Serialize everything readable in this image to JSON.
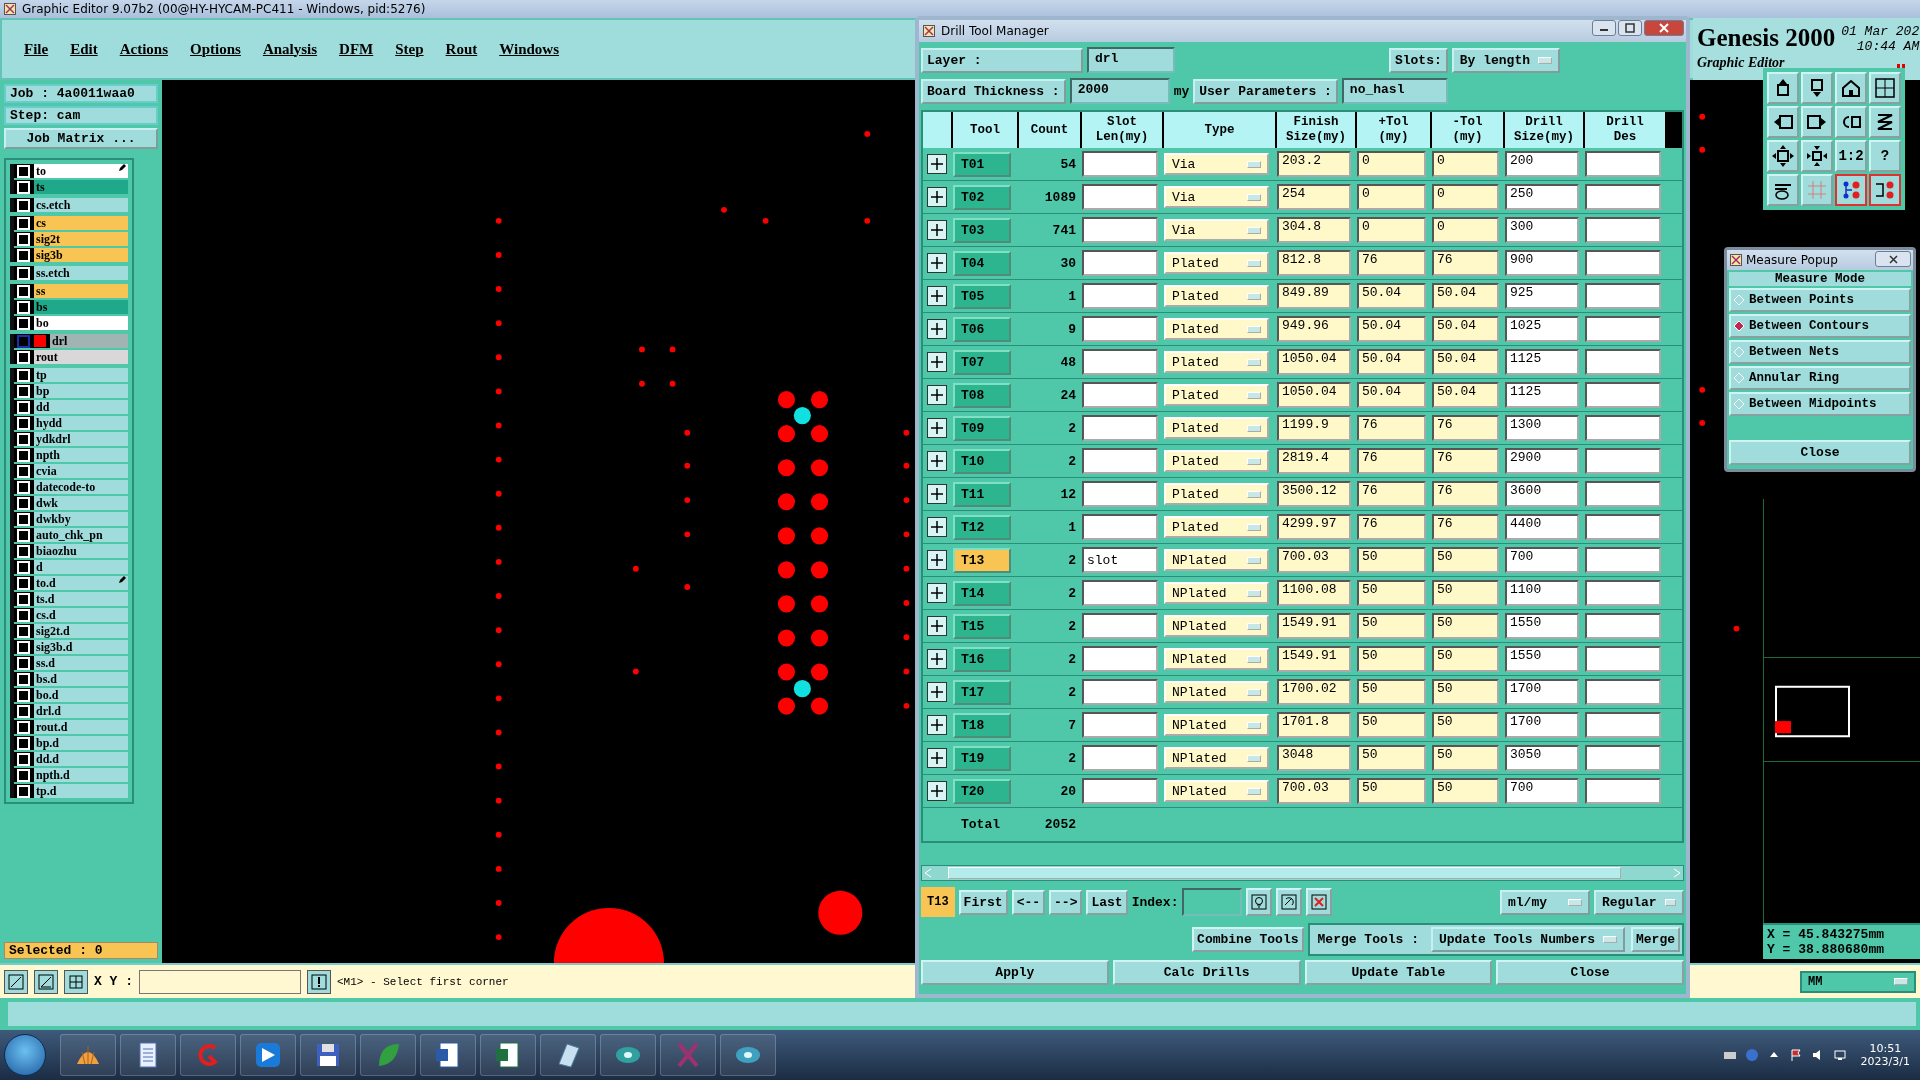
{
  "app_window": {
    "title": "Graphic Editor 9.07b2 (00@HY-HYCAM-PC411 - Windows, pid:5276)"
  },
  "menu": [
    "File",
    "Edit",
    "Actions",
    "Options",
    "Analysis",
    "DFM",
    "Step",
    "Rout",
    "Windows"
  ],
  "job": {
    "job": "Job : 4a0011waa0",
    "step": "Step: cam",
    "matrix_button": "Job Matrix ..."
  },
  "layer_groups": [
    {
      "layers": [
        {
          "name": "to",
          "color": "#ffffff",
          "selected": false,
          "marked": true
        },
        {
          "name": "ts",
          "color": "#1fa88a",
          "selected": false,
          "marked": false
        }
      ]
    },
    {
      "layers": [
        {
          "name": "cs.etch",
          "color": "#a0dcdc",
          "selected": false,
          "marked": false
        }
      ]
    },
    {
      "layers": [
        {
          "name": "cs",
          "color": "#f8c454",
          "selected": false,
          "marked": false
        },
        {
          "name": "sig2t",
          "color": "#f8c454",
          "selected": false,
          "marked": false
        },
        {
          "name": "sig3b",
          "color": "#f8c454",
          "selected": false,
          "marked": false
        }
      ]
    },
    {
      "layers": [
        {
          "name": "ss.etch",
          "color": "#a0dcdc",
          "selected": false,
          "marked": false
        }
      ]
    },
    {
      "layers": [
        {
          "name": "ss",
          "color": "#f8c454",
          "selected": false,
          "marked": false
        },
        {
          "name": "bs",
          "color": "#1fa88a",
          "selected": false,
          "marked": false
        },
        {
          "name": "bo",
          "color": "#ffffff",
          "selected": false,
          "marked": false
        }
      ]
    },
    {
      "layers": [
        {
          "name": "drl",
          "color": "#a0b4b4",
          "selected": true,
          "marked": false
        },
        {
          "name": "rout",
          "color": "#d8d8d8",
          "selected": false,
          "marked": false
        }
      ]
    },
    {
      "layers": [
        {
          "name": "tp",
          "color": "#a0dcdc",
          "selected": false,
          "marked": false
        },
        {
          "name": "bp",
          "color": "#a0dcdc",
          "selected": false,
          "marked": false
        },
        {
          "name": "dd",
          "color": "#a0dcdc",
          "selected": false,
          "marked": false
        },
        {
          "name": "hydd",
          "color": "#a0dcdc",
          "selected": false,
          "marked": false
        },
        {
          "name": "ydkdrl",
          "color": "#a0dcdc",
          "selected": false,
          "marked": false
        },
        {
          "name": "npth",
          "color": "#a0dcdc",
          "selected": false,
          "marked": false
        },
        {
          "name": "cvia",
          "color": "#a0dcdc",
          "selected": false,
          "marked": false
        },
        {
          "name": "datecode-to",
          "color": "#a0dcdc",
          "selected": false,
          "marked": false
        },
        {
          "name": "dwk",
          "color": "#a0dcdc",
          "selected": false,
          "marked": false
        },
        {
          "name": "dwkby",
          "color": "#a0dcdc",
          "selected": false,
          "marked": false
        },
        {
          "name": "auto_chk_pn",
          "color": "#a0dcdc",
          "selected": false,
          "marked": false
        },
        {
          "name": "biaozhu",
          "color": "#a0dcdc",
          "selected": false,
          "marked": false
        },
        {
          "name": "d",
          "color": "#a0dcdc",
          "selected": false,
          "marked": false
        },
        {
          "name": "to.d",
          "color": "#a0dcdc",
          "selected": false,
          "marked": true
        },
        {
          "name": "ts.d",
          "color": "#a0dcdc",
          "selected": false,
          "marked": false
        },
        {
          "name": "cs.d",
          "color": "#a0dcdc",
          "selected": false,
          "marked": false
        },
        {
          "name": "sig2t.d",
          "color": "#a0dcdc",
          "selected": false,
          "marked": false
        },
        {
          "name": "sig3b.d",
          "color": "#a0dcdc",
          "selected": false,
          "marked": false
        },
        {
          "name": "ss.d",
          "color": "#a0dcdc",
          "selected": false,
          "marked": false
        },
        {
          "name": "bs.d",
          "color": "#a0dcdc",
          "selected": false,
          "marked": false
        },
        {
          "name": "bo.d",
          "color": "#a0dcdc",
          "selected": false,
          "marked": false
        },
        {
          "name": "drl.d",
          "color": "#a0dcdc",
          "selected": false,
          "marked": false
        },
        {
          "name": "rout.d",
          "color": "#a0dcdc",
          "selected": false,
          "marked": false
        },
        {
          "name": "bp.d",
          "color": "#a0dcdc",
          "selected": false,
          "marked": false
        },
        {
          "name": "dd.d",
          "color": "#a0dcdc",
          "selected": false,
          "marked": false
        },
        {
          "name": "npth.d",
          "color": "#a0dcdc",
          "selected": false,
          "marked": false
        },
        {
          "name": "tp.d",
          "color": "#a0dcdc",
          "selected": false,
          "marked": false
        }
      ]
    }
  ],
  "selected_count": "Selected : 0",
  "brand": {
    "name": "Genesis 2000",
    "subtitle": "Graphic Editor",
    "date": "01 Mar 202",
    "time": "10:44 AM"
  },
  "toolbar": [
    {
      "on": false
    },
    {
      "on": false
    },
    {
      "on": false
    },
    {
      "on": false
    },
    {
      "on": false
    },
    {
      "on": false
    },
    {
      "on": false
    },
    {
      "on": false
    },
    {
      "on": false
    },
    {
      "on": false
    },
    {
      "label": "1:2",
      "on": false
    },
    {
      "label": "?",
      "on": false
    },
    {
      "on": false
    },
    {
      "on": false
    },
    {
      "on": true
    },
    {
      "on": true
    }
  ],
  "coordinates": {
    "x": "X = 45.843275mm",
    "y": "Y = 38.880680mm"
  },
  "command_bar": {
    "xy_label": "X Y :",
    "prompt": "<M1> - Select first corner",
    "units": "MM"
  },
  "drill_tool_manager": {
    "title": "Drill Tool Manager",
    "layer_label": "Layer :",
    "layer_value": "drl",
    "slots_label": "Slots:",
    "slots_value": "By length",
    "thickness_label": "Board Thickness :",
    "thickness_value": "2000",
    "thickness_unit": "my",
    "user_params_label": "User Parameters :",
    "user_params_value": "no_hasl",
    "columns": [
      "Tool",
      "Count",
      "Slot\nLen(my)",
      "Type",
      "Finish\nSize(my)",
      "+Tol\n(my)",
      "-Tol\n(my)",
      "Drill\nSize(my)",
      "Drill\nDes"
    ],
    "rows": [
      {
        "tool": "T01",
        "count": "54",
        "slot_len": "",
        "type": "Via",
        "finish": "203.2",
        "plus_tol": "0",
        "minus_tol": "0",
        "drill_size": "200",
        "selected": false
      },
      {
        "tool": "T02",
        "count": "1089",
        "slot_len": "",
        "type": "Via",
        "finish": "254",
        "plus_tol": "0",
        "minus_tol": "0",
        "drill_size": "250",
        "selected": false
      },
      {
        "tool": "T03",
        "count": "741",
        "slot_len": "",
        "type": "Via",
        "finish": "304.8",
        "plus_tol": "0",
        "minus_tol": "0",
        "drill_size": "300",
        "selected": false
      },
      {
        "tool": "T04",
        "count": "30",
        "slot_len": "",
        "type": "Plated",
        "finish": "812.8",
        "plus_tol": "76",
        "minus_tol": "76",
        "drill_size": "900",
        "selected": false
      },
      {
        "tool": "T05",
        "count": "1",
        "slot_len": "",
        "type": "Plated",
        "finish": "849.89",
        "plus_tol": "50.04",
        "minus_tol": "50.04",
        "drill_size": "925",
        "selected": false
      },
      {
        "tool": "T06",
        "count": "9",
        "slot_len": "",
        "type": "Plated",
        "finish": "949.96",
        "plus_tol": "50.04",
        "minus_tol": "50.04",
        "drill_size": "1025",
        "selected": false
      },
      {
        "tool": "T07",
        "count": "48",
        "slot_len": "",
        "type": "Plated",
        "finish": "1050.04",
        "plus_tol": "50.04",
        "minus_tol": "50.04",
        "drill_size": "1125",
        "selected": false
      },
      {
        "tool": "T08",
        "count": "24",
        "slot_len": "",
        "type": "Plated",
        "finish": "1050.04",
        "plus_tol": "50.04",
        "minus_tol": "50.04",
        "drill_size": "1125",
        "selected": false
      },
      {
        "tool": "T09",
        "count": "2",
        "slot_len": "",
        "type": "Plated",
        "finish": "1199.9",
        "plus_tol": "76",
        "minus_tol": "76",
        "drill_size": "1300",
        "selected": false
      },
      {
        "tool": "T10",
        "count": "2",
        "slot_len": "",
        "type": "Plated",
        "finish": "2819.4",
        "plus_tol": "76",
        "minus_tol": "76",
        "drill_size": "2900",
        "selected": false
      },
      {
        "tool": "T11",
        "count": "12",
        "slot_len": "",
        "type": "Plated",
        "finish": "3500.12",
        "plus_tol": "76",
        "minus_tol": "76",
        "drill_size": "3600",
        "selected": false
      },
      {
        "tool": "T12",
        "count": "1",
        "slot_len": "",
        "type": "Plated",
        "finish": "4299.97",
        "plus_tol": "76",
        "minus_tol": "76",
        "drill_size": "4400",
        "selected": false
      },
      {
        "tool": "T13",
        "count": "2",
        "slot_len": "slot",
        "type": "NPlated",
        "finish": "700.03",
        "plus_tol": "50",
        "minus_tol": "50",
        "drill_size": "700",
        "selected": true
      },
      {
        "tool": "T14",
        "count": "2",
        "slot_len": "",
        "type": "NPlated",
        "finish": "1100.08",
        "plus_tol": "50",
        "minus_tol": "50",
        "drill_size": "1100",
        "selected": false
      },
      {
        "tool": "T15",
        "count": "2",
        "slot_len": "",
        "type": "NPlated",
        "finish": "1549.91",
        "plus_tol": "50",
        "minus_tol": "50",
        "drill_size": "1550",
        "selected": false
      },
      {
        "tool": "T16",
        "count": "2",
        "slot_len": "",
        "type": "NPlated",
        "finish": "1549.91",
        "plus_tol": "50",
        "minus_tol": "50",
        "drill_size": "1550",
        "selected": false
      },
      {
        "tool": "T17",
        "count": "2",
        "slot_len": "",
        "type": "NPlated",
        "finish": "1700.02",
        "plus_tol": "50",
        "minus_tol": "50",
        "drill_size": "1700",
        "selected": false
      },
      {
        "tool": "T18",
        "count": "7",
        "slot_len": "",
        "type": "NPlated",
        "finish": "1701.8",
        "plus_tol": "50",
        "minus_tol": "50",
        "drill_size": "1700",
        "selected": false
      },
      {
        "tool": "T19",
        "count": "2",
        "slot_len": "",
        "type": "NPlated",
        "finish": "3048",
        "plus_tol": "50",
        "minus_tol": "50",
        "drill_size": "3050",
        "selected": false
      },
      {
        "tool": "T20",
        "count": "20",
        "slot_len": "",
        "type": "NPlated",
        "finish": "700.03",
        "plus_tol": "50",
        "minus_tol": "50",
        "drill_size": "700",
        "selected": false
      }
    ],
    "total_label": "Total",
    "total_count": "2052",
    "current_tool": "T13",
    "nav_buttons": [
      "First",
      "<--",
      "-->",
      "Last"
    ],
    "index_label": "Index:",
    "units": "ml/my",
    "mode": "Regular",
    "combine_button": "Combine Tools",
    "merge_label": "Merge Tools :",
    "merge_option": "Update Tools Numbers",
    "merge_button": "Merge",
    "actions": [
      "Apply",
      "Calc Drills",
      "Update Table",
      "Close"
    ]
  },
  "measure_popup": {
    "title": "Measure Popup",
    "heading": "Measure Mode",
    "options": [
      {
        "label": "Between Points",
        "selected": false
      },
      {
        "label": "Between Contours",
        "selected": true
      },
      {
        "label": "Between Nets",
        "selected": false
      },
      {
        "label": "Annular Ring",
        "selected": false
      },
      {
        "label": "Between Midpoints",
        "selected": false
      }
    ],
    "close_button": "Close"
  },
  "taskbar": {
    "time": "10:51",
    "date": "2023/3/1"
  }
}
